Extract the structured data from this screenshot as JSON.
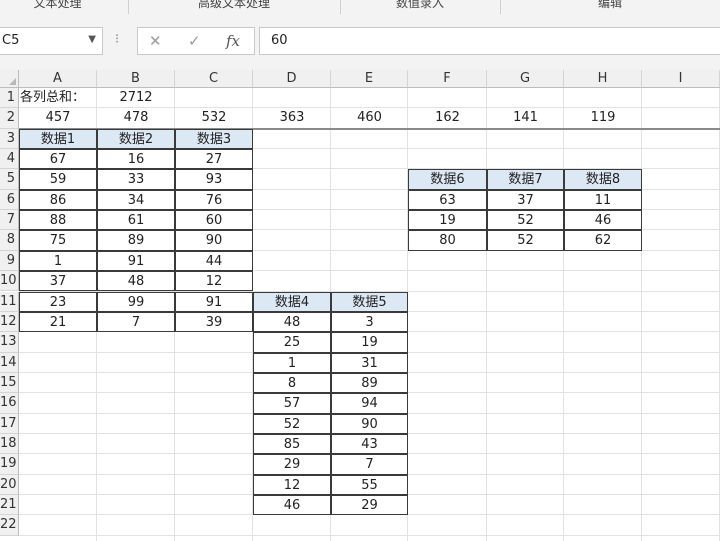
{
  "ribbon": {
    "groups": [
      "文本处理",
      "高级文本处理",
      "数值录入",
      "编辑"
    ]
  },
  "formula_bar": {
    "name_box": "C5",
    "cancel_glyph": "✕",
    "enter_glyph": "✓",
    "fx_glyph": "fx",
    "content": "60"
  },
  "columns": [
    "A",
    "B",
    "C",
    "D",
    "E",
    "F",
    "G",
    "H",
    "I"
  ],
  "rows": [
    "1",
    "2",
    "3",
    "4",
    "5",
    "6",
    "7",
    "8",
    "9",
    "10",
    "11",
    "12",
    "13",
    "14",
    "15",
    "16",
    "17",
    "18",
    "19",
    "20",
    "21",
    "22"
  ],
  "summary": {
    "label": "各列总和：",
    "total": "2712",
    "column_sums": [
      "457",
      "478",
      "532",
      "363",
      "460",
      "162",
      "141",
      "119"
    ]
  },
  "table1": {
    "headers": [
      "数据1",
      "数据2",
      "数据3"
    ],
    "rows": [
      [
        "67",
        "16",
        "27"
      ],
      [
        "59",
        "33",
        "93"
      ],
      [
        "86",
        "34",
        "76"
      ],
      [
        "88",
        "61",
        "60"
      ],
      [
        "75",
        "89",
        "90"
      ],
      [
        "1",
        "91",
        "44"
      ],
      [
        "37",
        "48",
        "12"
      ],
      [
        "23",
        "99",
        "91"
      ],
      [
        "21",
        "7",
        "39"
      ]
    ]
  },
  "table2": {
    "headers": [
      "数据4",
      "数据5"
    ],
    "rows": [
      [
        "48",
        "3"
      ],
      [
        "25",
        "19"
      ],
      [
        "1",
        "31"
      ],
      [
        "8",
        "89"
      ],
      [
        "57",
        "94"
      ],
      [
        "52",
        "90"
      ],
      [
        "85",
        "43"
      ],
      [
        "29",
        "7"
      ],
      [
        "12",
        "55"
      ],
      [
        "46",
        "29"
      ]
    ]
  },
  "table3": {
    "headers": [
      "数据6",
      "数据7",
      "数据8"
    ],
    "rows": [
      [
        "63",
        "37",
        "11"
      ],
      [
        "19",
        "52",
        "46"
      ],
      [
        "80",
        "52",
        "62"
      ]
    ]
  }
}
